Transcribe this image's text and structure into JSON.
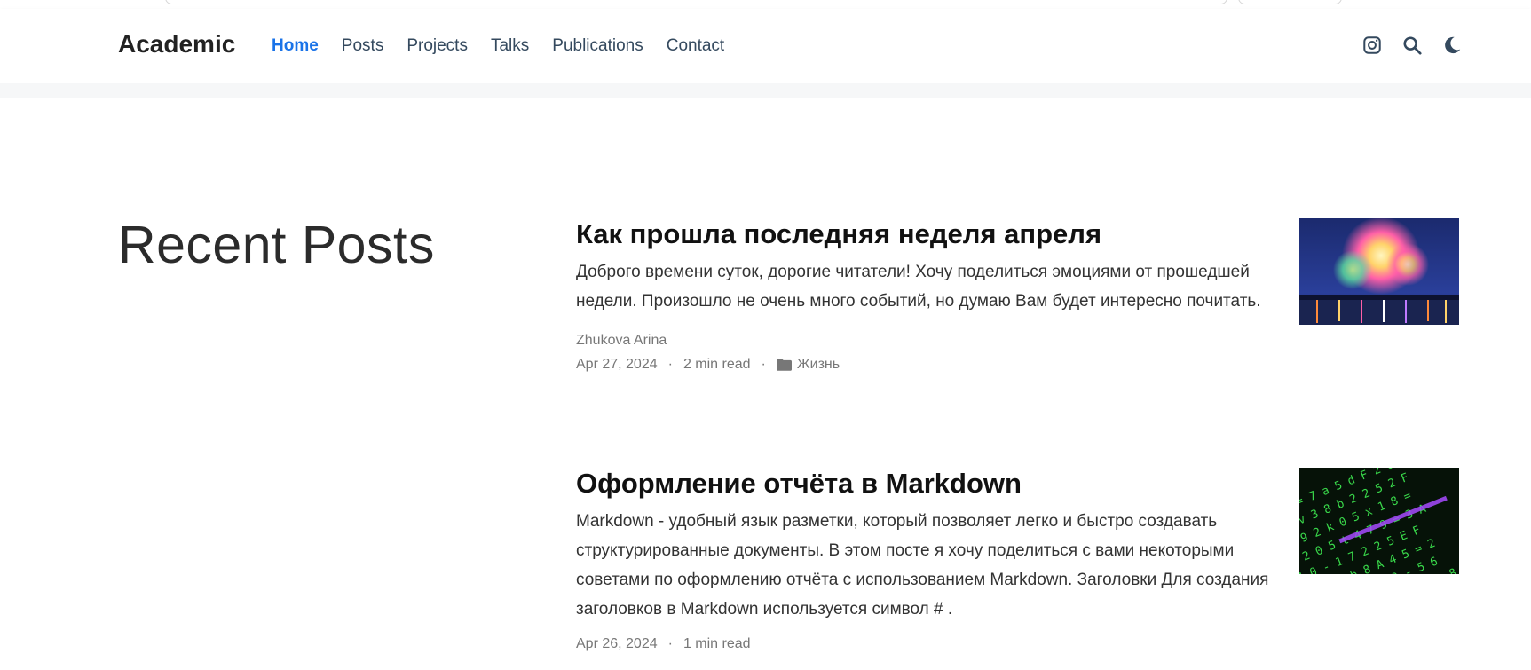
{
  "site": {
    "brand": "Academic"
  },
  "nav": {
    "items": [
      {
        "label": "Home",
        "active": true
      },
      {
        "label": "Posts",
        "active": false
      },
      {
        "label": "Projects",
        "active": false
      },
      {
        "label": "Talks",
        "active": false
      },
      {
        "label": "Publications",
        "active": false
      },
      {
        "label": "Contact",
        "active": false
      }
    ],
    "icons": [
      "instagram-icon",
      "search-icon",
      "moon-icon"
    ]
  },
  "section": {
    "title": "Recent Posts"
  },
  "posts": [
    {
      "title": "Как прошла последняя неделя апреля",
      "summary": "Доброго времени суток, дорогие читатели! Хочу поделиться эмоциями от прошедшей недели. Произошло не очень много событий, но думаю Вам будет интересно почитать.",
      "author": "Zhukova Arina",
      "date": "Apr 27, 2024",
      "reading_time": "2 min read",
      "category": "Жизнь",
      "thumbnail": "fireworks-image"
    },
    {
      "title": "Оформление отчёта в Markdown",
      "summary": "Markdown - удобный язык разметки, который позволяет легко и быстро создавать структурированные документы. В этом посте я хочу поделиться с вами некоторыми советами по оформлению отчёта с использованием Markdown. Заголовки Для создания заголовков в Markdown используется символ # .",
      "date": "Apr 26, 2024",
      "reading_time": "1 min read",
      "thumbnail": "code-image"
    }
  ],
  "colors": {
    "accent": "#1a73e8",
    "text": "#34495e",
    "title": "#111111",
    "meta": "#777777"
  }
}
